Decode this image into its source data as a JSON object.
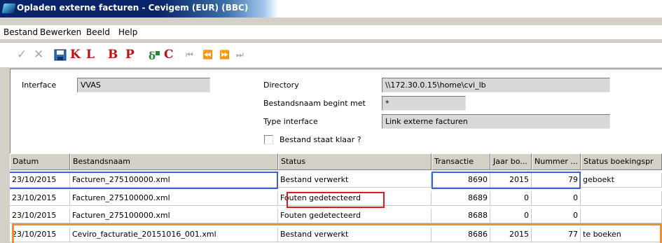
{
  "window": {
    "title": "Opladen externe facturen - Cevigem (EUR) (BBC)"
  },
  "menu": [
    "Bestand",
    "Bewerken",
    "Beeld",
    "Help"
  ],
  "toolbar": {
    "confirm": "✓",
    "cancel": "✕",
    "letters": [
      "K",
      "L",
      "B",
      "P"
    ],
    "c_letter": "C",
    "nav": [
      "⏮",
      "⏪",
      "⏩",
      "⏭"
    ]
  },
  "form": {
    "interface_label": "Interface",
    "interface_value": "VVAS",
    "directory_label": "Directory",
    "directory_value": "\\\\172.30.0.15\\home\\cvi_lb",
    "bestandsnaam_label": "Bestandsnaam begint met",
    "bestandsnaam_value": "*",
    "type_label": "Type interface",
    "type_value": "Link externe facturen",
    "klaar_label": "Bestand staat klaar ?",
    "klaar_checked": false
  },
  "grid": {
    "columns": [
      "Datum",
      "Bestandsnaam",
      "Status",
      "Transactie",
      "Jaar bo...",
      "Nummer ...",
      "Status boekingspr"
    ],
    "rows": [
      [
        "23/10/2015",
        "Facturen_275100000.xml",
        "Bestand verwerkt",
        "8690",
        "2015",
        "79",
        "geboekt"
      ],
      [
        "23/10/2015",
        "Facturen_275100000.xml",
        "Fouten gedetecteerd",
        "8689",
        "0",
        "0",
        ""
      ],
      [
        "23/10/2015",
        "Facturen_275100000.xml",
        "Fouten gedetecteerd",
        "8688",
        "0",
        "0",
        ""
      ],
      [
        "23/10/2015",
        "Ceviro_facturatie_20151016_001.xml",
        "Bestand verwerkt",
        "8686",
        "2015",
        "77",
        "te boeken"
      ]
    ]
  },
  "colors": {
    "title_bar": "#0a246a",
    "toolbar_letters": "#c01010",
    "highlight_blue": "#3c64d8",
    "highlight_red": "#e01a1a",
    "highlight_orange": "#f0902a"
  }
}
